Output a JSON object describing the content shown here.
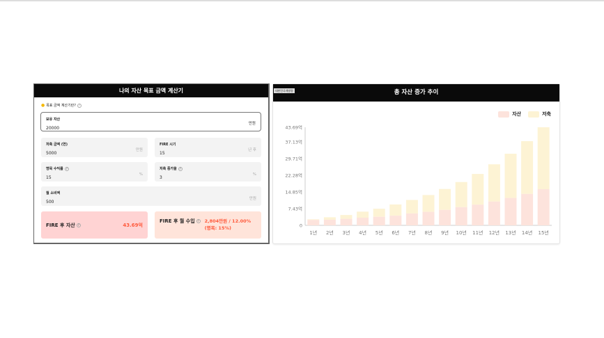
{
  "calculator": {
    "title": "나의 자산 목표 금액 계산기",
    "hint": "목표 금액 계산기란?",
    "fields": {
      "assets": {
        "label": "보유 자산",
        "value": "20000",
        "unit": "만원"
      },
      "savings": {
        "label": "저축 금액 (연)",
        "value": "5000",
        "unit": "만원"
      },
      "fire_time": {
        "label": "FIRE 시기",
        "value": "15",
        "unit": "년 후"
      },
      "return_rate": {
        "label": "명목 수익률",
        "value": "15",
        "unit": "%"
      },
      "savings_growth": {
        "label": "저축 증가율",
        "value": "3",
        "unit": "%"
      },
      "monthly_spend": {
        "label": "월 소비액",
        "value": "500",
        "unit": "만원"
      }
    },
    "results": {
      "fire_assets": {
        "label": "FIRE 후 자산",
        "value": "43.69억"
      },
      "fire_income": {
        "label": "FIRE 후 월 수입",
        "value": "2,804만원 / 12.00% (명목: 15%)"
      }
    }
  },
  "chart_panel": {
    "title": "총 자산 증가 추이",
    "tag": "대한민국개발왕"
  },
  "colors": {
    "asset": "#fde3dc",
    "savings": "#fdf3d4"
  },
  "chart_data": {
    "type": "bar",
    "stacked": true,
    "categories": [
      "1년",
      "2년",
      "3년",
      "4년",
      "5년",
      "6년",
      "7년",
      "8년",
      "9년",
      "10년",
      "11년",
      "12년",
      "13년",
      "14년",
      "15년"
    ],
    "series": [
      {
        "name": "자산",
        "values": [
          2.4,
          2.5,
          2.9,
          3.4,
          3.8,
          4.3,
          5.3,
          6.0,
          6.9,
          8.1,
          9.2,
          10.6,
          12.2,
          14.0,
          16.1
        ]
      },
      {
        "name": "저축",
        "values": [
          0.3,
          1.1,
          1.7,
          2.7,
          3.6,
          5.0,
          6.0,
          7.5,
          9.3,
          11.2,
          13.7,
          16.6,
          19.7,
          23.5,
          27.59
        ]
      }
    ],
    "yticks": [
      "0",
      "7.43억",
      "14.85억",
      "22.28억",
      "29.71억",
      "37.13억",
      "43.69억"
    ],
    "ytick_values": [
      0,
      7.43,
      14.85,
      22.28,
      29.71,
      37.13,
      43.69
    ],
    "ylim": [
      0,
      43.69
    ],
    "legend": "top-right"
  }
}
